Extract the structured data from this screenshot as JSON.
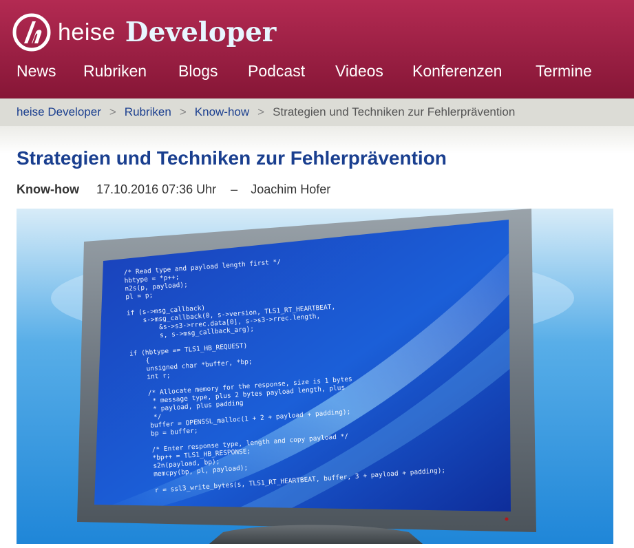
{
  "brand": {
    "logo_icon": "heise-logo-icon",
    "heise_text": "heise",
    "section_text": "Developer",
    "colors": {
      "header": "#9a1f43",
      "title": "#1a3f8f",
      "link": "#1b3f8f"
    }
  },
  "nav": {
    "items": [
      {
        "label": "News"
      },
      {
        "label": "Rubriken"
      },
      {
        "label": "Blogs"
      },
      {
        "label": "Podcast"
      },
      {
        "label": "Videos"
      },
      {
        "label": "Konferenzen"
      },
      {
        "label": "Termine"
      }
    ]
  },
  "breadcrumb": {
    "items": [
      {
        "label": "heise Developer"
      },
      {
        "label": "Rubriken"
      },
      {
        "label": "Know-how"
      }
    ],
    "separator": ">",
    "current": "Strategien und Techniken zur Fehlerprävention"
  },
  "article": {
    "title": "Strategien und Techniken zur Fehlerprävention",
    "rubric": "Know-how",
    "date": "17.10.2016 07:36 Uhr",
    "dash": "–",
    "author": "Joachim Hofer",
    "hero_image": {
      "icon": "monitor-code-image",
      "code_lines": [
        "/* Read type and payload length first */",
        "hbtype = *p++;",
        "n2s(p, payload);",
        "pl = p;",
        "",
        "if (s->msg_callback)",
        "    s->msg_callback(0, s->version, TLS1_RT_HEARTBEAT,",
        "        &s->s3->rrec.data[0], s->s3->rrec.length,",
        "        s, s->msg_callback_arg);",
        "",
        "if (hbtype == TLS1_HB_REQUEST)",
        "    {",
        "    unsigned char *buffer, *bp;",
        "    int r;",
        "",
        "    /* Allocate memory for the response, size is 1 bytes",
        "     * message type, plus 2 bytes payload length, plus",
        "     * payload, plus padding",
        "     */",
        "    buffer = OPENSSL_malloc(1 + 2 + payload + padding);",
        "    bp = buffer;",
        "",
        "    /* Enter response type, length and copy payload */",
        "    *bp++ = TLS1_HB_RESPONSE;",
        "    s2n(payload, bp);",
        "    memcpy(bp, pl, payload);",
        "",
        "    r = ssl3_write_bytes(s, TLS1_RT_HEARTBEAT, buffer, 3 + payload + padding);"
      ]
    }
  }
}
